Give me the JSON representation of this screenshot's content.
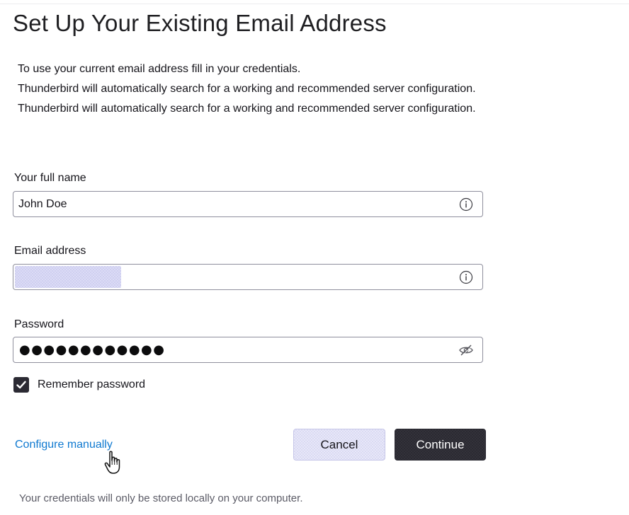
{
  "header": {
    "title": "Set Up Your Existing Email Address"
  },
  "intro": {
    "lines": [
      "To use your current email address fill in your credentials.",
      "Thunderbird will automatically search for a working and recommended server configuration.",
      "Thunderbird will automatically search for a working and recommended server configuration."
    ]
  },
  "form": {
    "full_name": {
      "label": "Your full name",
      "value": "John Doe",
      "icon": "info-icon"
    },
    "email": {
      "label": "Email address",
      "value": "",
      "icon": "info-icon"
    },
    "password": {
      "label": "Password",
      "masked_value": "●●●●●●●●●●●●",
      "icon": "eye-slash-icon"
    },
    "remember": {
      "label": "Remember password",
      "checked": true
    }
  },
  "actions": {
    "configure_label": "Configure manually",
    "cancel_label": "Cancel",
    "continue_label": "Continue"
  },
  "footer": {
    "note": "Your credentials will only be stored locally on your computer."
  },
  "colors": {
    "link": "#0f79d0",
    "primary_button": "#2b2a33",
    "secondary_button": "#e8e8f8",
    "field_border": "#8f8f9d"
  }
}
